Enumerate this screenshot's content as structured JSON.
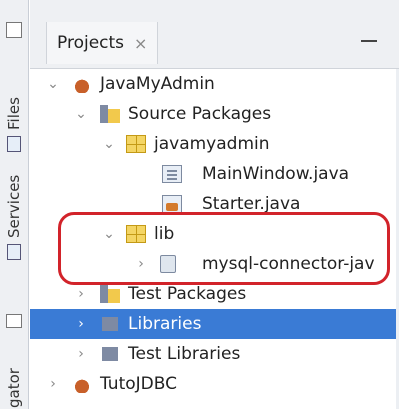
{
  "sidebar": {
    "tabs": [
      {
        "label": "Files",
        "icon": "files-icon"
      },
      {
        "label": "Services",
        "icon": "services-icon"
      },
      {
        "label": "gator",
        "icon": "navigator-icon"
      }
    ]
  },
  "tabs": [
    {
      "label": "Projects",
      "close": "×"
    }
  ],
  "tree": [
    {
      "label": "JavaMyAdmin",
      "icon": "java-project-icon"
    },
    {
      "label": "Source Packages",
      "icon": "source-packages-icon"
    },
    {
      "label": "javamyadmin",
      "icon": "package-icon"
    },
    {
      "label": "MainWindow.java",
      "icon": "java-file-icon"
    },
    {
      "label": "Starter.java",
      "icon": "java-main-file-icon"
    },
    {
      "label": "lib",
      "icon": "package-icon"
    },
    {
      "label": "mysql-connector-jav",
      "icon": "jar-file-icon"
    },
    {
      "label": "Test Packages",
      "icon": "test-packages-icon"
    },
    {
      "label": "Libraries",
      "icon": "libraries-icon",
      "selected": true
    },
    {
      "label": "Test Libraries",
      "icon": "test-libraries-icon"
    },
    {
      "label": "TutoJDBC",
      "icon": "java-project-icon"
    }
  ],
  "colors": {
    "selection": "#3a7bd5",
    "highlight_annotation": "#d2232a"
  }
}
